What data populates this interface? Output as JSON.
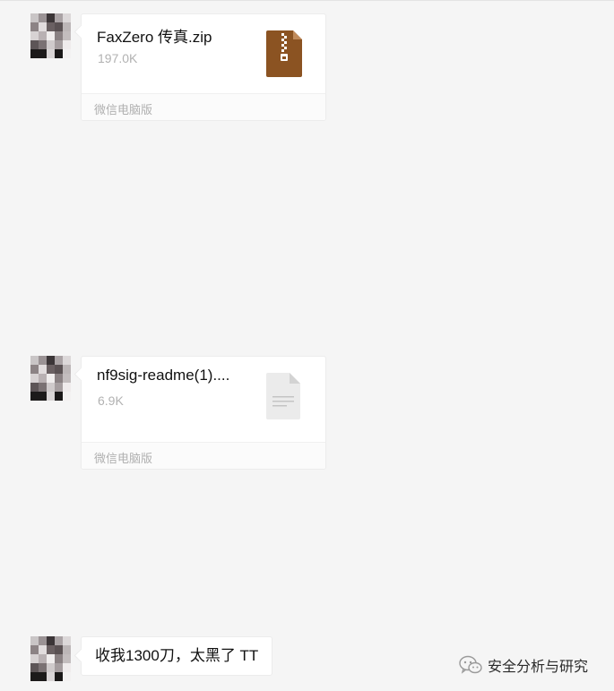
{
  "messages": [
    {
      "type": "file",
      "file_name": "FaxZero 传真.zip",
      "file_size": "197.0K",
      "source": "微信电脑版",
      "icon": "zip-archive-icon"
    },
    {
      "type": "file",
      "file_name": "nf9sig-readme(1)....",
      "file_size": "6.9K",
      "source": "微信电脑版",
      "icon": "text-document-icon"
    },
    {
      "type": "text",
      "text": "收我1300刀，太黑了 TT"
    }
  ],
  "watermark": {
    "text": "安全分析与研究",
    "icon": "wechat-icon"
  },
  "colors": {
    "background": "#f5f5f5",
    "bubble": "#ffffff",
    "zip_icon": "#8b5322",
    "doc_icon": "#e8e8e8"
  }
}
